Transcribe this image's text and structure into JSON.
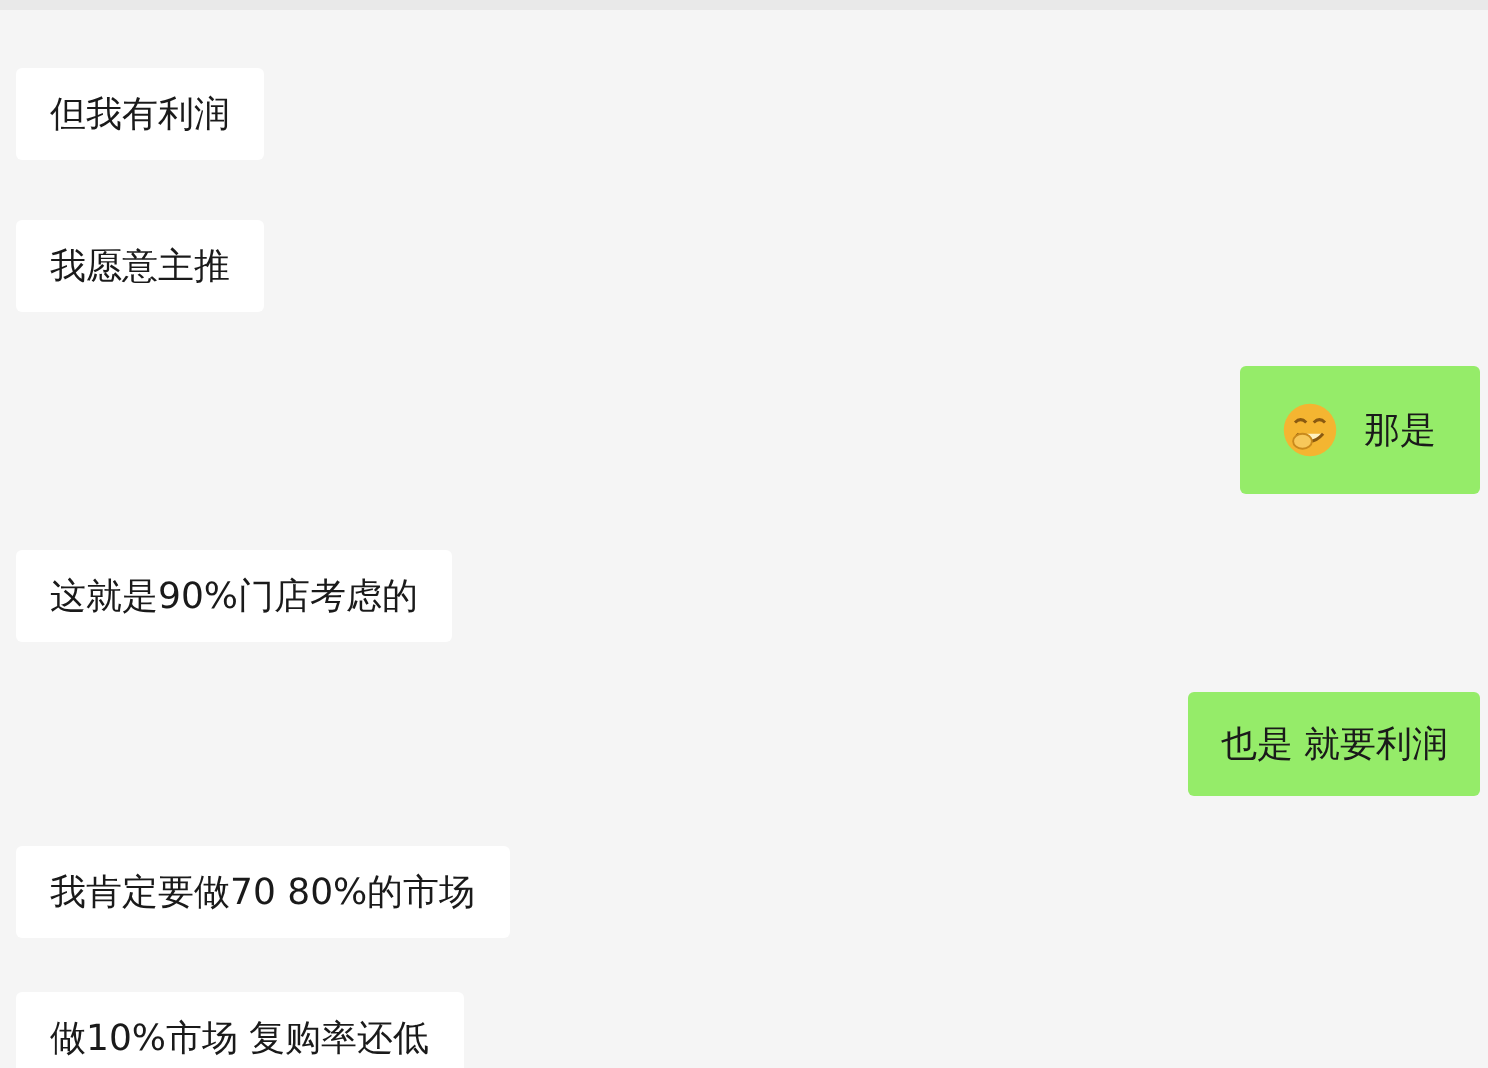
{
  "messages": [
    {
      "outgoing": false,
      "kind": "text",
      "text": "但我有利润"
    },
    {
      "outgoing": false,
      "kind": "text",
      "text": "我愿意主推"
    },
    {
      "outgoing": true,
      "kind": "emoji_text",
      "text": "那是"
    },
    {
      "outgoing": false,
      "kind": "text",
      "text": "这就是90%门店考虑的"
    },
    {
      "outgoing": true,
      "kind": "text",
      "text": "也是 就要利润"
    },
    {
      "outgoing": false,
      "kind": "text",
      "text": "我肯定要做70 80%的市场"
    },
    {
      "outgoing": false,
      "kind": "text",
      "text": "做10%市场 复购率还低"
    }
  ]
}
